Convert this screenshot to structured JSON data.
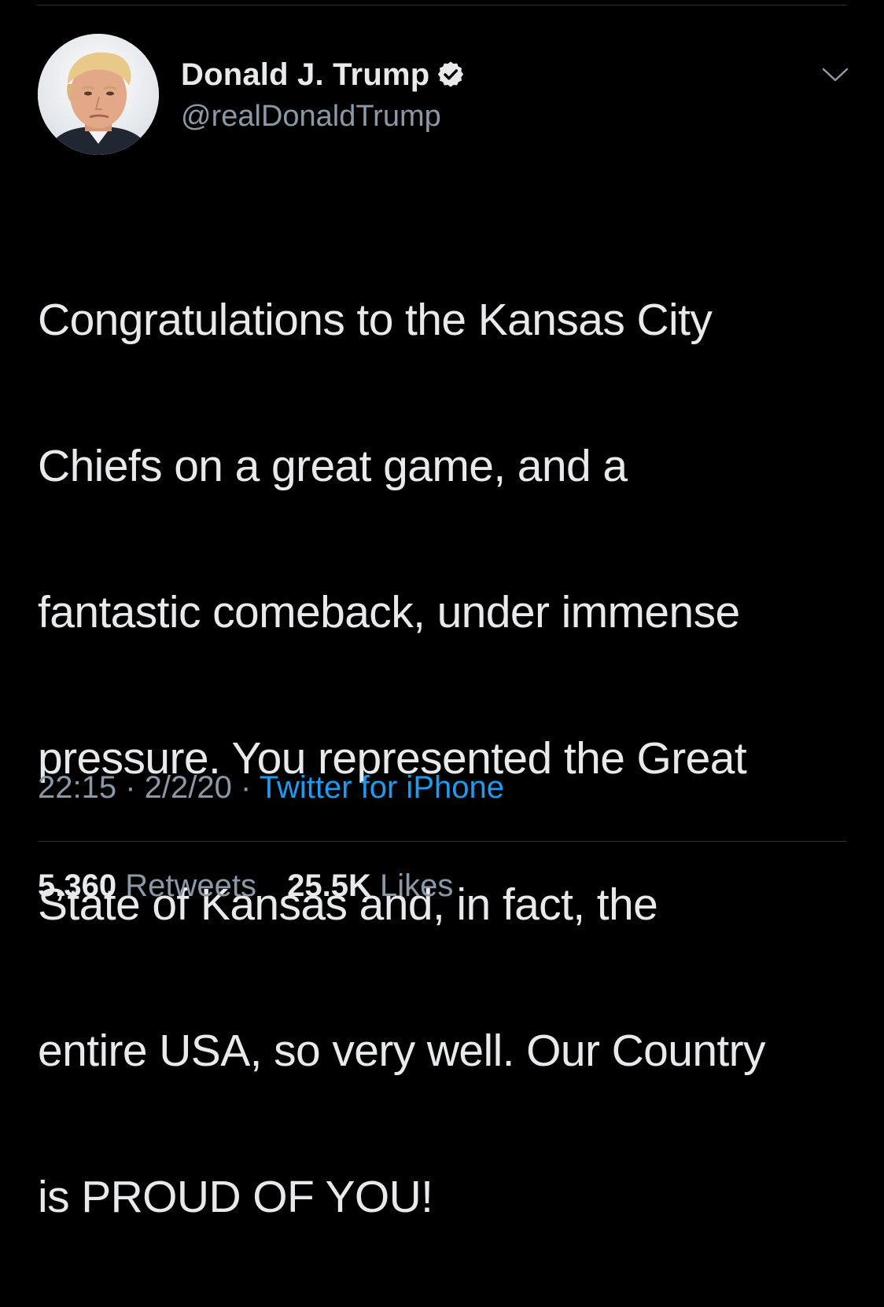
{
  "author": {
    "display_name": "Donald J. Trump",
    "handle": "@realDonaldTrump",
    "verified": true
  },
  "tweet": {
    "lines": [
      "Congratulations to the Kansas City",
      "Chiefs on a great game, and a",
      "fantastic comeback, under immense",
      "pressure. You represented the Great",
      "State of Kansas and, in fact, the",
      "entire USA, so very well. Our Country",
      "is PROUD OF YOU!"
    ]
  },
  "meta": {
    "time": "22:15",
    "separator": "·",
    "date": "2/2/20",
    "source": "Twitter for iPhone"
  },
  "stats": {
    "retweets_count": "5,360",
    "retweets_label": "Retweets",
    "likes_count": "25.5K",
    "likes_label": "Likes"
  },
  "colors": {
    "background": "#000000",
    "text_primary": "#e7e9ea",
    "text_secondary": "#8b98a5",
    "accent": "#1d9bf0",
    "divider": "#2f3336"
  },
  "icons": {
    "verified": "verified-badge-icon",
    "menu": "chevron-down-icon"
  }
}
